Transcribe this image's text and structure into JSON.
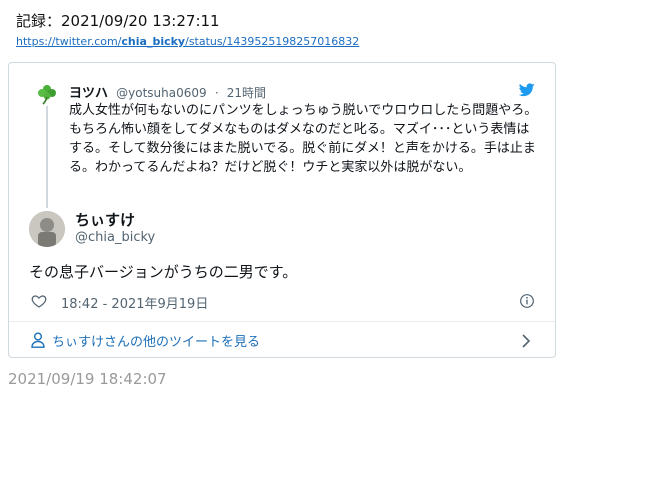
{
  "record": {
    "title": "記録：2021/09/20 13:27:11",
    "link_prefix": "https://twitter.com/",
    "link_user": "chia_bicky",
    "link_suffix": "/status/1439525198257016832"
  },
  "quoted_tweet": {
    "name": "ヨツハ",
    "handle": "@yotsuha0609",
    "separator": "·",
    "time": "21時間",
    "text": "成人女性が何もないのにパンツをしょっちゅう脱いでウロウロしたら問題やろ。もちろん怖い顔をしてダメなものはダメなのだと叱る。マズイ･･･という表情はする。そして数分後にはまた脱いでる。脱ぐ前にダメ！と声をかける。手は止まる。わかってるんだよね？だけど脱ぐ！ウチと実家以外は脱がない。"
  },
  "tweet": {
    "name": "ちぃすけ",
    "handle": "@chia_bicky",
    "text": "その息子バージョンがうちの二男です。",
    "timestamp": "18:42 - 2021年9月19日",
    "more_label": "ちぃすけさんの他のツイートを見る"
  },
  "footer": {
    "captured_time": "2021/09/19 18:42:07"
  },
  "colors": {
    "twitter_blue": "#1d9bf0",
    "link_blue": "#1b6ec2",
    "secondary_text": "#536471"
  }
}
